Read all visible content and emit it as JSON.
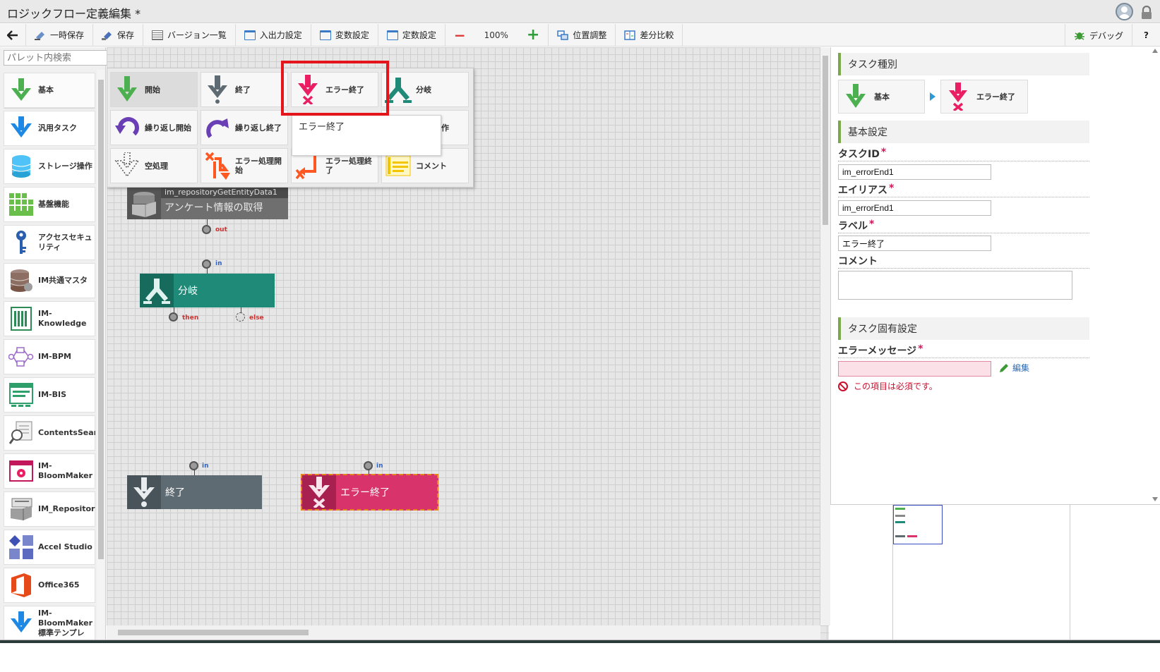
{
  "window": {
    "title": "ロジックフロー定義編集 *"
  },
  "toolbar": {
    "back_label": "",
    "temp_save": "一時保存",
    "save": "保存",
    "versions": "バージョン一覧",
    "io_settings": "入出力設定",
    "var_settings": "変数設定",
    "const_settings": "定数設定",
    "zoom": "100%",
    "position_adjust": "位置調整",
    "diff_compare": "差分比較",
    "debug": "デバッグ",
    "help": "?"
  },
  "palette": {
    "search_placeholder": "パレット内検索",
    "items": [
      {
        "label": "基本",
        "icon": "down-arrow-green-icon"
      },
      {
        "label": "汎用タスク",
        "icon": "down-arrow-blue-icon"
      },
      {
        "label": "ストレージ操作",
        "icon": "storage-icon"
      },
      {
        "label": "基盤機能",
        "icon": "grid-icon"
      },
      {
        "label": "アクセスセキュリティ",
        "icon": "key-icon"
      },
      {
        "label": "IM共通マスタ",
        "icon": "database-icon"
      },
      {
        "label": "IM-Knowledge",
        "icon": "book-icon"
      },
      {
        "label": "IM-BPM",
        "icon": "process-icon"
      },
      {
        "label": "IM-BIS",
        "icon": "form-icon"
      },
      {
        "label": "ContentsSearch",
        "icon": "search-doc-icon"
      },
      {
        "label": "IM-BloomMaker",
        "icon": "bloom-icon"
      },
      {
        "label": "IM_Repository",
        "icon": "repository-icon"
      },
      {
        "label": "Accel Studio",
        "icon": "accel-icon"
      },
      {
        "label": "Office365",
        "icon": "office-icon"
      },
      {
        "label": "IM-BloomMaker標準テンプレ",
        "icon": "down-arrow-blue-icon"
      }
    ]
  },
  "popup": {
    "items": [
      {
        "label": "開始",
        "icon": "start-icon"
      },
      {
        "label": "終了",
        "icon": "end-icon"
      },
      {
        "label": "エラー終了",
        "icon": "error-end-icon"
      },
      {
        "label": "分岐",
        "icon": "branch-icon"
      },
      {
        "label": "繰り返し開始",
        "icon": "loop-start-icon"
      },
      {
        "label": "繰り返し終了",
        "icon": "loop-end-icon"
      },
      {
        "label": "作",
        "icon": "hidden-icon"
      },
      {
        "label": "空処理",
        "icon": "noop-icon"
      },
      {
        "label": "エラー処理開始",
        "icon": "error-handle-start-icon"
      },
      {
        "label": "エラー処理終了",
        "icon": "error-handle-end-icon"
      },
      {
        "label": "コメント",
        "icon": "comment-icon"
      }
    ],
    "tooltip": "エラー終了"
  },
  "canvas": {
    "nodes": {
      "repo_id": "im_repositoryGetEntityData1",
      "repo_label": "アンケート情報の取得",
      "branch_label": "分岐",
      "end_label": "終了",
      "error_end_label": "エラー終了"
    },
    "ports": {
      "out": "out",
      "in": "in",
      "then": "then",
      "else": "else"
    }
  },
  "props": {
    "task_type_header": "タスク種別",
    "task_type_category": "基本",
    "task_type_name": "エラー終了",
    "basic_header": "基本設定",
    "task_id_label": "タスクID",
    "task_id_value": "im_errorEnd1",
    "alias_label": "エイリアス",
    "alias_value": "im_errorEnd1",
    "label_label": "ラベル",
    "label_value": "エラー終了",
    "comment_label": "コメント",
    "comment_value": "",
    "specific_header": "タスク固有設定",
    "error_message_label": "エラーメッセージ",
    "error_message_value": "",
    "edit_label": "編集",
    "required_error": "この項目は必須です。",
    "required_mark": "*"
  },
  "colors": {
    "start_green": "#4caf50",
    "error_pink": "#d9336b",
    "end_slate": "#5f6b73",
    "branch_teal": "#1f8a78",
    "accent_blue": "#2c6cb3"
  }
}
